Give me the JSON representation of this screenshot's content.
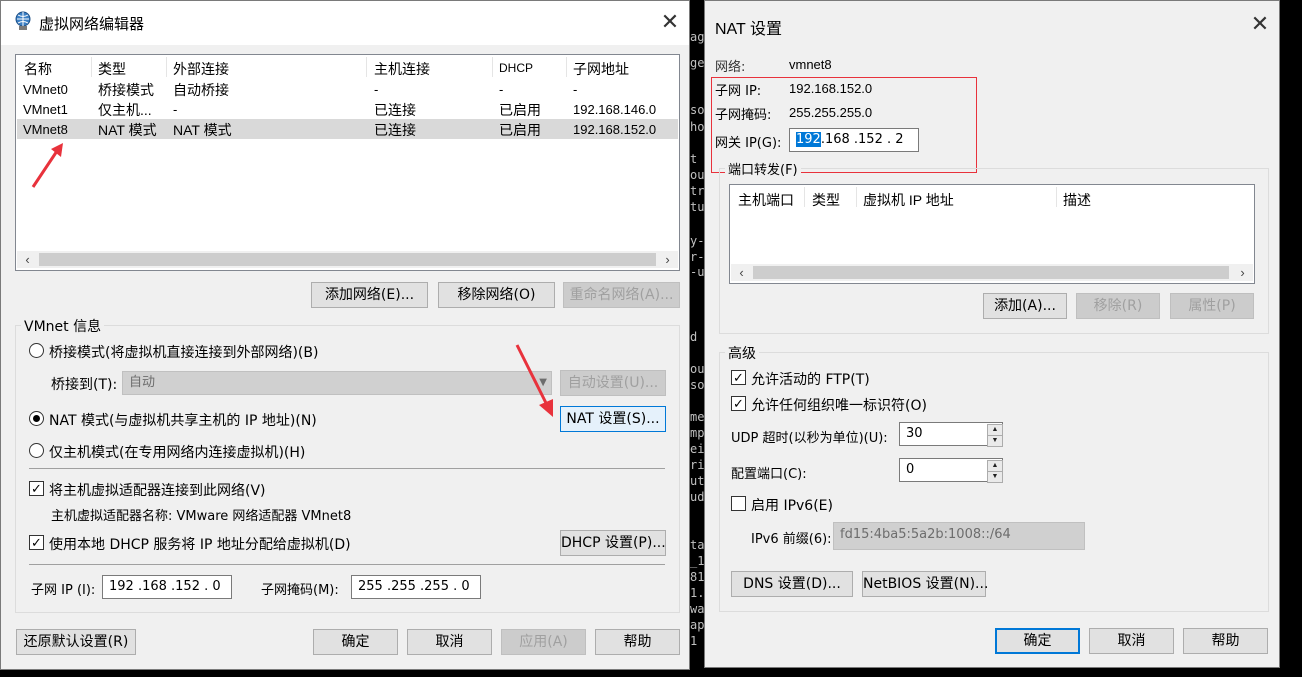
{
  "left": {
    "title": "虚拟网络编辑器",
    "columns": [
      "名称",
      "类型",
      "外部连接",
      "主机连接",
      "DHCP",
      "子网地址"
    ],
    "rows": [
      {
        "name": "VMnet0",
        "type": "桥接模式",
        "external": "自动桥接",
        "host": "-",
        "dhcp": "-",
        "subnet": "-"
      },
      {
        "name": "VMnet1",
        "type": "仅主机...",
        "external": "-",
        "host": "已连接",
        "dhcp": "已启用",
        "subnet": "192.168.146.0"
      },
      {
        "name": "VMnet8",
        "type": "NAT 模式",
        "external": "NAT 模式",
        "host": "已连接",
        "dhcp": "已启用",
        "subnet": "192.168.152.0"
      }
    ],
    "buttons": {
      "add": "添加网络(E)...",
      "remove": "移除网络(O)",
      "rename": "重命名网络(A)..."
    },
    "vmnet_info": "VMnet 信息",
    "bridge_mode": "桥接模式(将虚拟机直接连接到外部网络)(B)",
    "bridge_to_label": "桥接到(T):",
    "bridge_to_value": "自动",
    "auto_settings": "自动设置(U)...",
    "nat_mode": "NAT 模式(与虚拟机共享主机的 IP 地址)(N)",
    "nat_settings": "NAT 设置(S)...",
    "host_only": "仅主机模式(在专用网络内连接虚拟机)(H)",
    "connect_adapter": "将主机虚拟适配器连接到此网络(V)",
    "adapter_name": "主机虚拟适配器名称: VMware 网络适配器 VMnet8",
    "use_dhcp": "使用本地 DHCP 服务将 IP 地址分配给虚拟机(D)",
    "dhcp_settings": "DHCP 设置(P)...",
    "subnet_ip_label": "子网 IP (I):",
    "subnet_ip": "192 .168 .152 .  0",
    "subnet_mask_label": "子网掩码(M):",
    "subnet_mask": "255 .255 .255 .  0",
    "restore": "还原默认设置(R)",
    "ok": "确定",
    "cancel": "取消",
    "apply": "应用(A)",
    "help": "帮助"
  },
  "terminal": [
    "ag",
    "ge",
    "so",
    "ho",
    "t",
    "ou",
    "tr",
    "tu",
    "y-",
    "r-",
    "-u",
    "d",
    "ou",
    "so",
    "me",
    "mp",
    "ei",
    "ri",
    "ut",
    "ud",
    "ta",
    "_1",
    "81",
    "1.",
    "wa",
    "ap",
    "1"
  ],
  "right": {
    "title": "NAT 设置",
    "network_label": "网络:",
    "network_value": "vmnet8",
    "subnet_ip_label": "子网 IP:",
    "subnet_ip_value": "192.168.152.0",
    "subnet_mask_label": "子网掩码:",
    "subnet_mask_value": "255.255.255.0",
    "gateway_label": "网关 IP(G):",
    "gateway_first": "192",
    "gateway_rest": ".168 .152 .  2",
    "port_forward": "端口转发(F)",
    "pf_columns": [
      "主机端口",
      "类型",
      "虚拟机 IP 地址",
      "描述"
    ],
    "add": "添加(A)...",
    "remove": "移除(R)",
    "properties": "属性(P)",
    "advanced": "高级",
    "allow_ftp": "允许活动的 FTP(T)",
    "allow_oui": "允许任何组织唯一标识符(O)",
    "udp_label": "UDP 超时(以秒为单位)(U):",
    "udp_value": "30",
    "config_port_label": "配置端口(C):",
    "config_port_value": "0",
    "enable_ipv6": "启用 IPv6(E)",
    "ipv6_prefix_label": "IPv6 前缀(6):",
    "ipv6_prefix_value": "fd15:4ba5:5a2b:1008::/64",
    "dns": "DNS 设置(D)...",
    "netbios": "NetBIOS 设置(N)...",
    "ok": "确定",
    "cancel": "取消",
    "help": "帮助"
  },
  "colors": {
    "annotation": "#e8323c",
    "selection": "#0078d7"
  }
}
